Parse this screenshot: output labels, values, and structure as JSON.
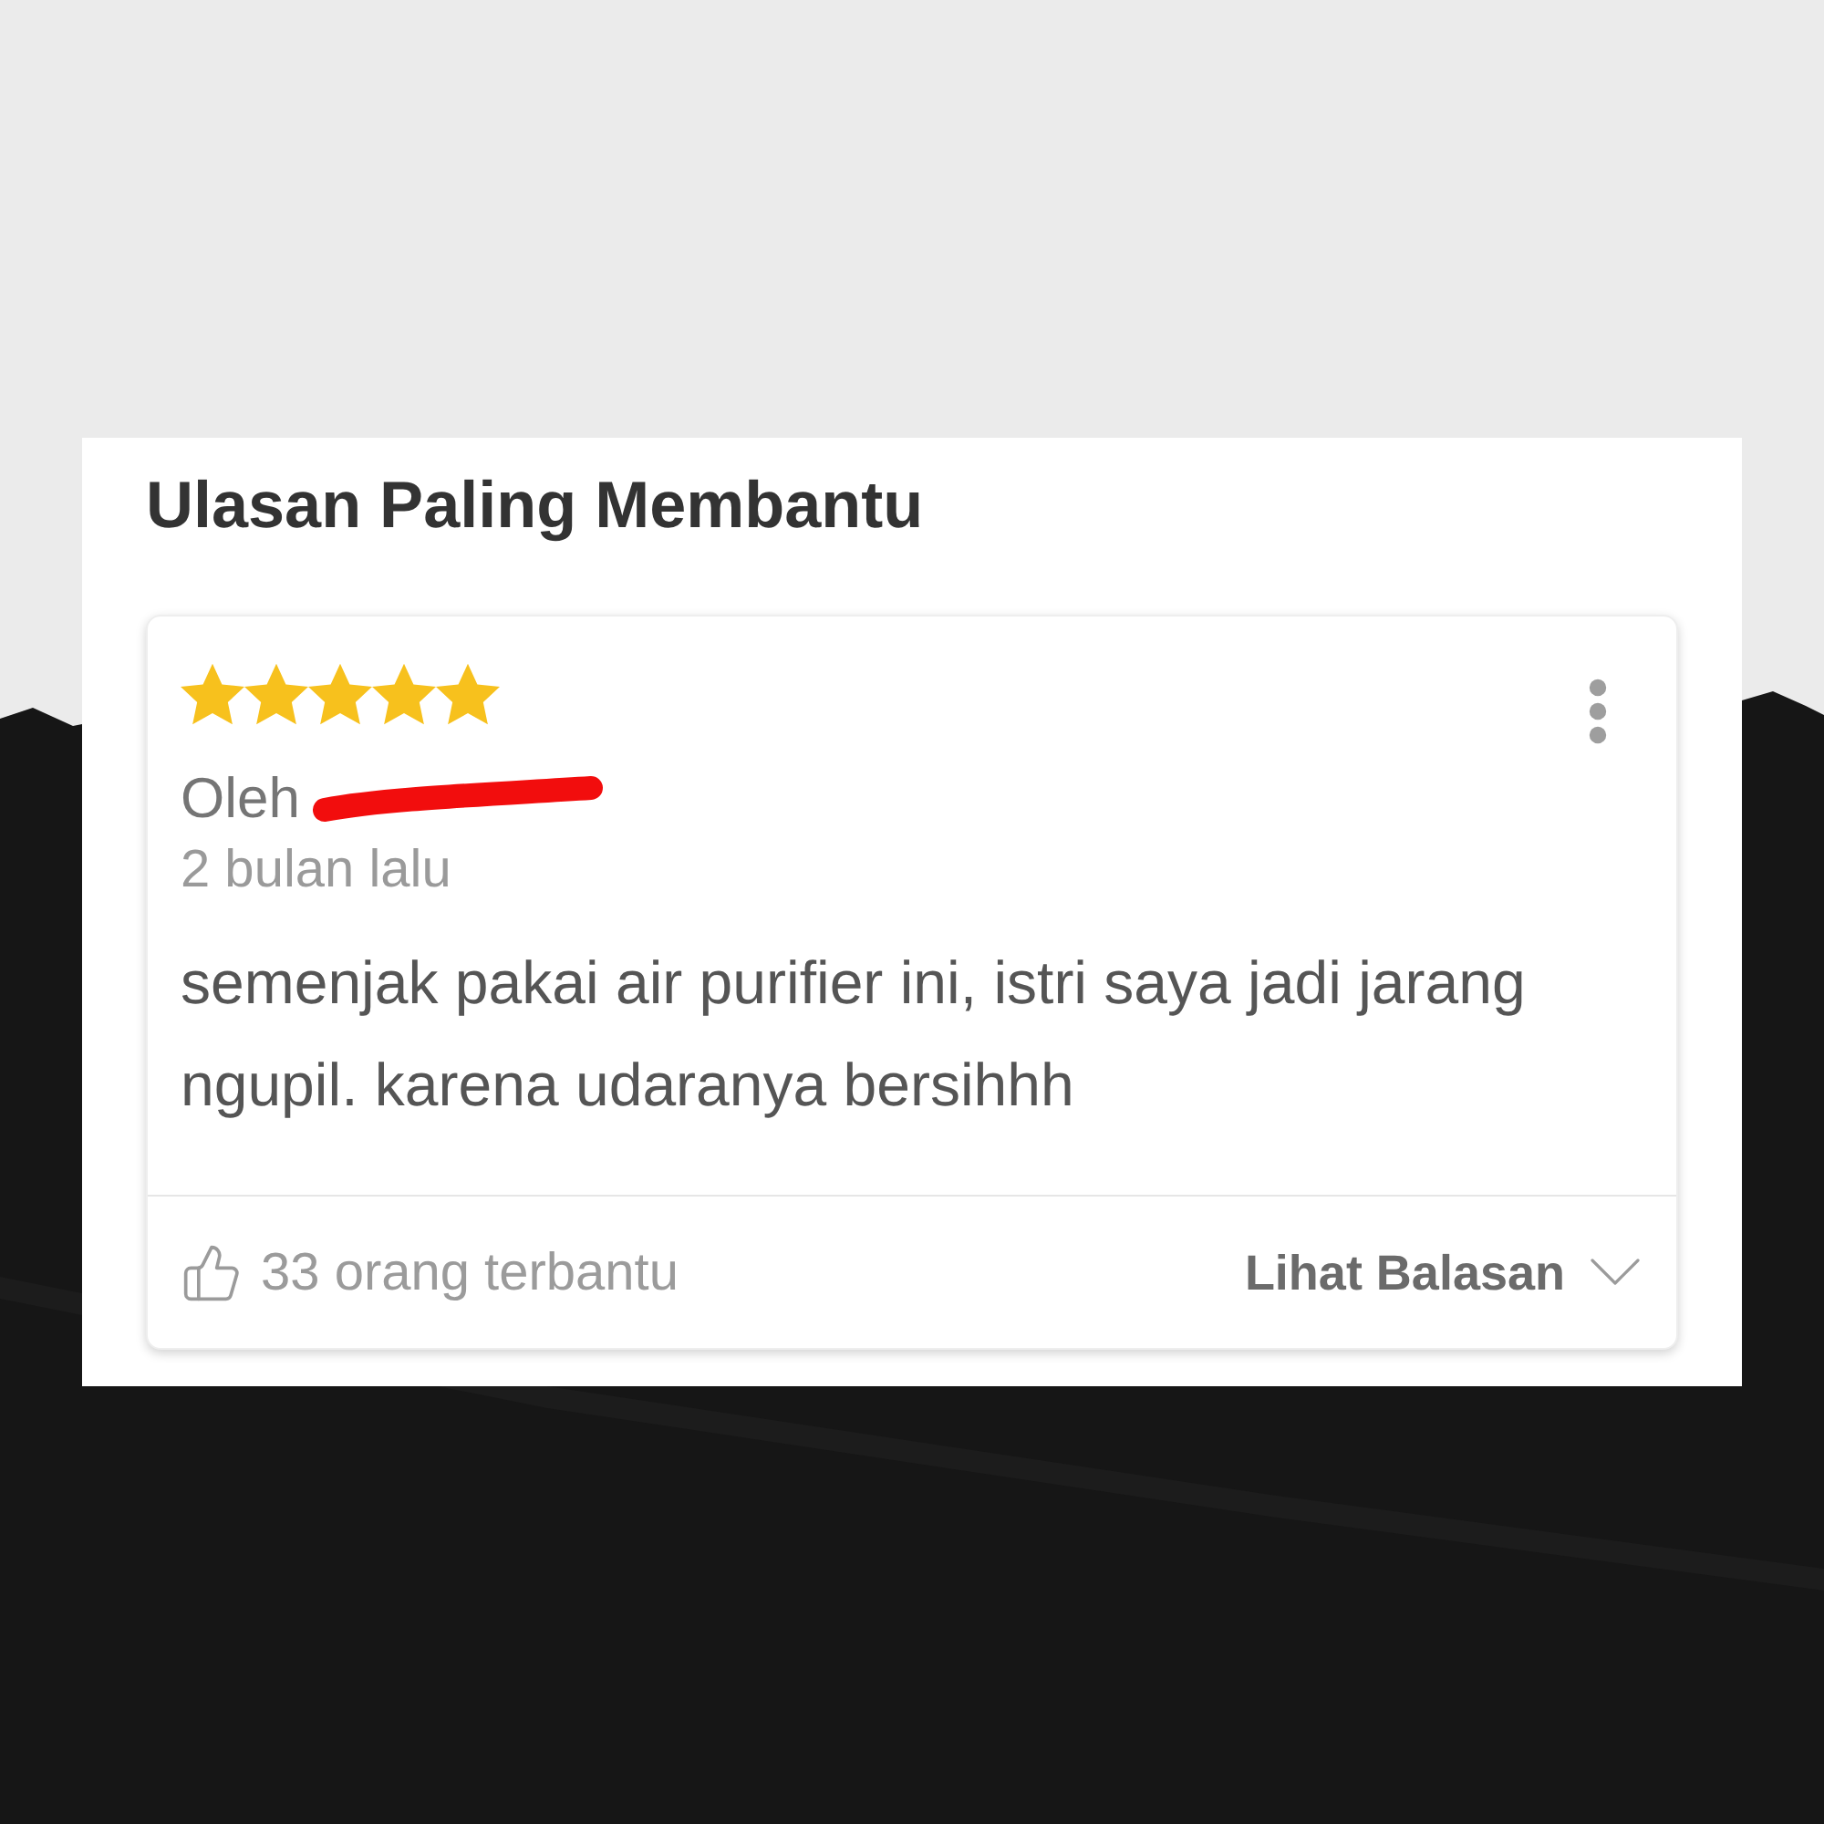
{
  "panel": {
    "title": "Ulasan Paling Membantu"
  },
  "review": {
    "stars": 5,
    "author_label": "Oleh",
    "author_redacted": true,
    "time": "2 bulan lalu",
    "text": "semenjak pakai air purifier ini, istri saya jadi jarang ngupil. karena udaranya bersihhh",
    "helpful": "33 orang terbantu",
    "replies_link": "Lihat Balasan"
  }
}
